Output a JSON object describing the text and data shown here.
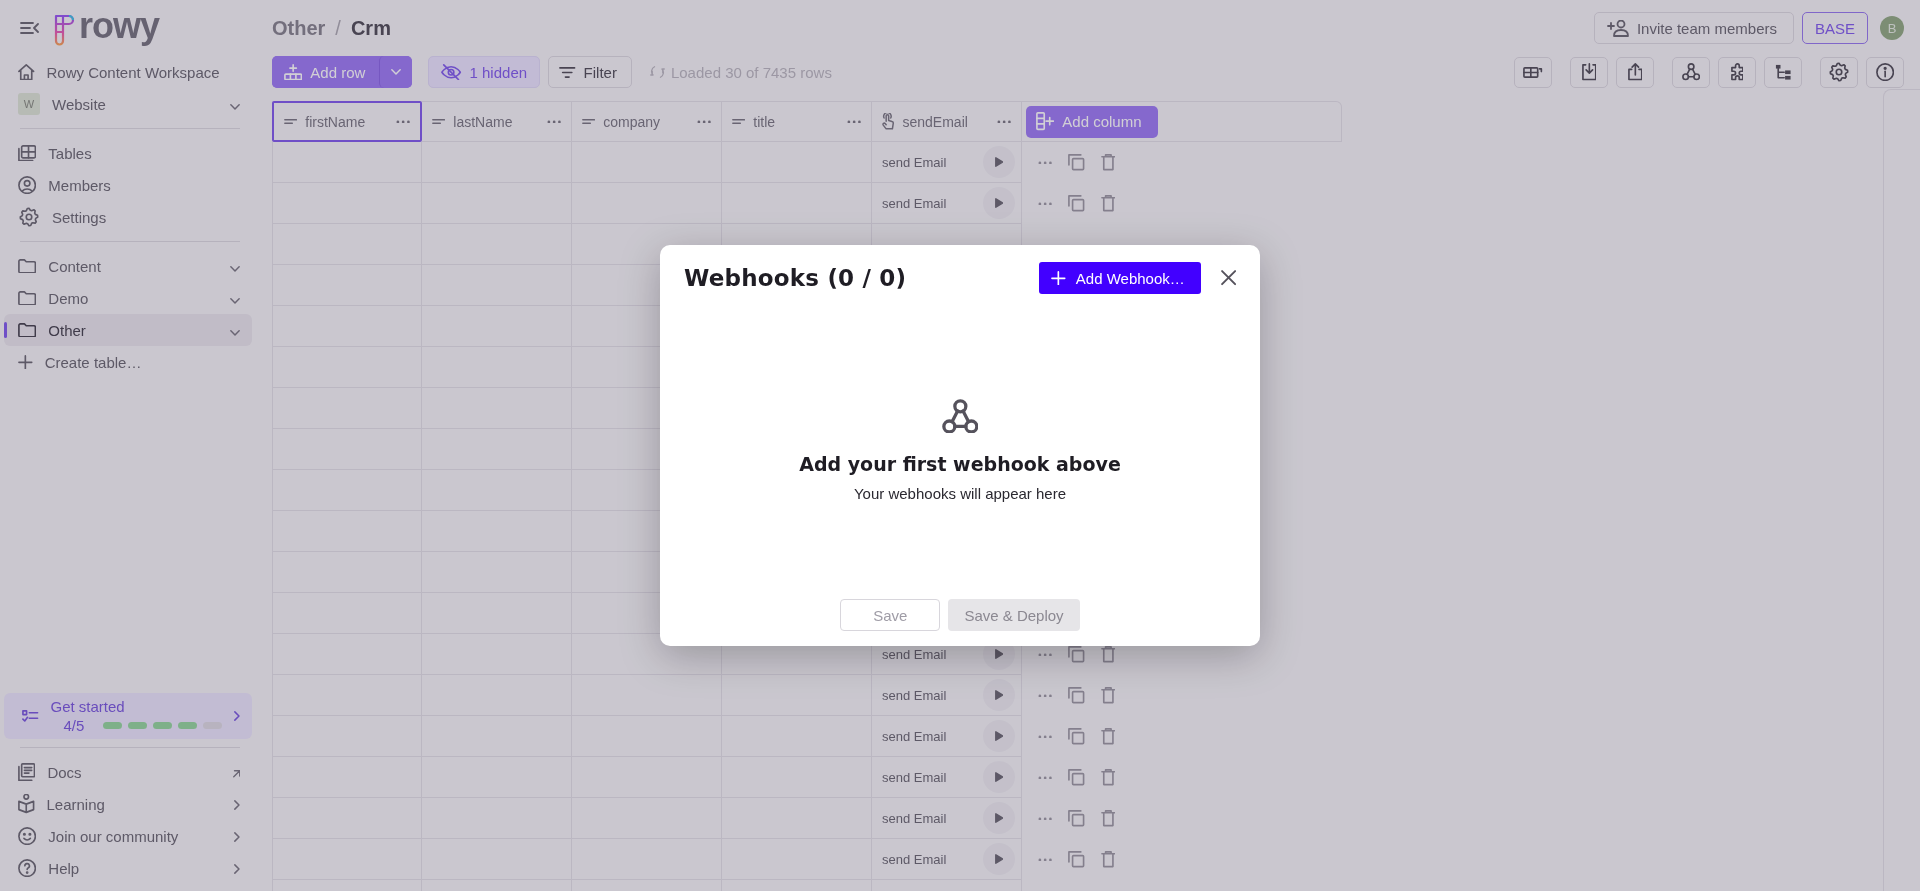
{
  "sidebar": {
    "logo_text": "rowy",
    "workspace": "Rowy Content Workspace",
    "project": {
      "initial": "W",
      "name": "Website"
    },
    "nav": [
      {
        "label": "Tables",
        "selected": false
      },
      {
        "label": "Members",
        "selected": false
      },
      {
        "label": "Settings",
        "selected": false
      }
    ],
    "sections": [
      {
        "label": "Content",
        "selected": false
      },
      {
        "label": "Demo",
        "selected": false
      },
      {
        "label": "Other",
        "selected": true
      }
    ],
    "create_table": "Create table…",
    "get_started": {
      "title": "Get started",
      "progress": "4/5",
      "steps": [
        {
          "done": true
        },
        {
          "done": true
        },
        {
          "done": true
        },
        {
          "done": true
        },
        {
          "done": false
        }
      ]
    },
    "footer": [
      {
        "label": "Docs",
        "kind": "external"
      },
      {
        "label": "Learning",
        "kind": "submenu"
      },
      {
        "label": "Join our community",
        "kind": "submenu"
      },
      {
        "label": "Help",
        "kind": "submenu"
      }
    ]
  },
  "breadcrumb": {
    "parent": "Other",
    "separator": "/",
    "current": "Crm"
  },
  "header_actions": {
    "invite": "Invite team members",
    "plan": "BASE",
    "avatar": "B"
  },
  "toolbar": {
    "add_row": "Add row",
    "hidden_columns": "1 hidden",
    "filter": "Filter",
    "status": "Loaded 30 of 7435 rows"
  },
  "table": {
    "columns": [
      {
        "name": "firstName",
        "kind": "text",
        "selected": true
      },
      {
        "name": "lastName",
        "kind": "text",
        "selected": false
      },
      {
        "name": "company",
        "kind": "text",
        "selected": false
      },
      {
        "name": "title",
        "kind": "text",
        "selected": false
      },
      {
        "name": "sendEmail",
        "kind": "action",
        "selected": false
      }
    ],
    "add_column": "Add column",
    "rows_above_dialog": [
      {
        "action_label": "send Email"
      },
      {
        "action_label": "send Email"
      }
    ],
    "rows_below_dialog": [
      {
        "action_label": "send Email"
      },
      {
        "action_label": "send Email"
      },
      {
        "action_label": "send Email"
      },
      {
        "action_label": "send Email"
      },
      {
        "action_label": "send Email"
      },
      {
        "action_label": "send Email"
      }
    ]
  },
  "dialog": {
    "title": "Webhooks (0 / 0)",
    "add_button": "Add Webhook…",
    "empty_title": "Add your first webhook above",
    "empty_text": "Your webhooks will appear here",
    "buttons": [
      {
        "label": "Save",
        "kind": "outlined",
        "disabled": true
      },
      {
        "label": "Save & Deploy",
        "kind": "contained",
        "disabled": true
      }
    ]
  }
}
